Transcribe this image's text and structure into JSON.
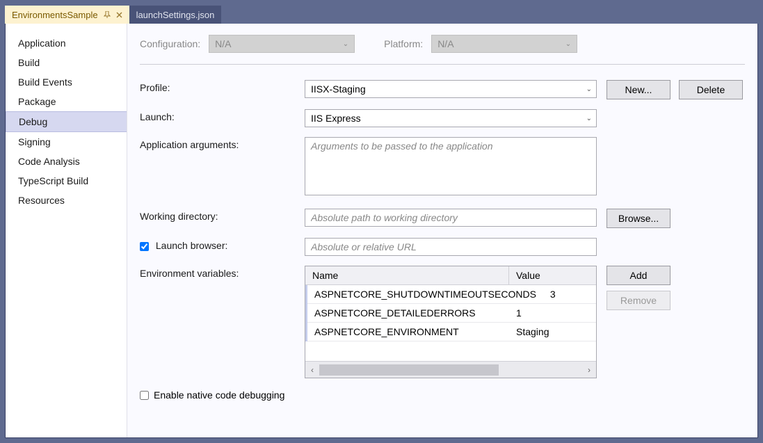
{
  "tabs": [
    {
      "label": "EnvironmentsSample",
      "active": true
    },
    {
      "label": "launchSettings.json",
      "active": false
    }
  ],
  "sidebar": {
    "items": [
      {
        "label": "Application"
      },
      {
        "label": "Build"
      },
      {
        "label": "Build Events"
      },
      {
        "label": "Package"
      },
      {
        "label": "Debug",
        "selected": true
      },
      {
        "label": "Signing"
      },
      {
        "label": "Code Analysis"
      },
      {
        "label": "TypeScript Build"
      },
      {
        "label": "Resources"
      }
    ]
  },
  "top": {
    "configuration_label": "Configuration:",
    "configuration_value": "N/A",
    "platform_label": "Platform:",
    "platform_value": "N/A"
  },
  "form": {
    "profile_label": "Profile:",
    "profile_value": "IISX-Staging",
    "new_btn": "New...",
    "delete_btn": "Delete",
    "launch_label": "Launch:",
    "launch_value": "IIS Express",
    "app_args_label": "Application arguments:",
    "app_args_placeholder": "Arguments to be passed to the application",
    "working_dir_label": "Working directory:",
    "working_dir_placeholder": "Absolute path to working directory",
    "browse_btn": "Browse...",
    "launch_browser_label": "Launch browser:",
    "launch_browser_checked": true,
    "launch_browser_placeholder": "Absolute or relative URL",
    "env_vars_label": "Environment variables:",
    "add_btn": "Add",
    "remove_btn": "Remove",
    "env_header_name": "Name",
    "env_header_value": "Value",
    "env_rows": [
      {
        "name": "ASPNETCORE_SHUTDOWNTIMEOUTSECONDS",
        "value": "3"
      },
      {
        "name": "ASPNETCORE_DETAILEDERRORS",
        "value": "1"
      },
      {
        "name": "ASPNETCORE_ENVIRONMENT",
        "value": "Staging"
      }
    ],
    "native_debug_label": "Enable native code debugging",
    "native_debug_checked": false
  }
}
